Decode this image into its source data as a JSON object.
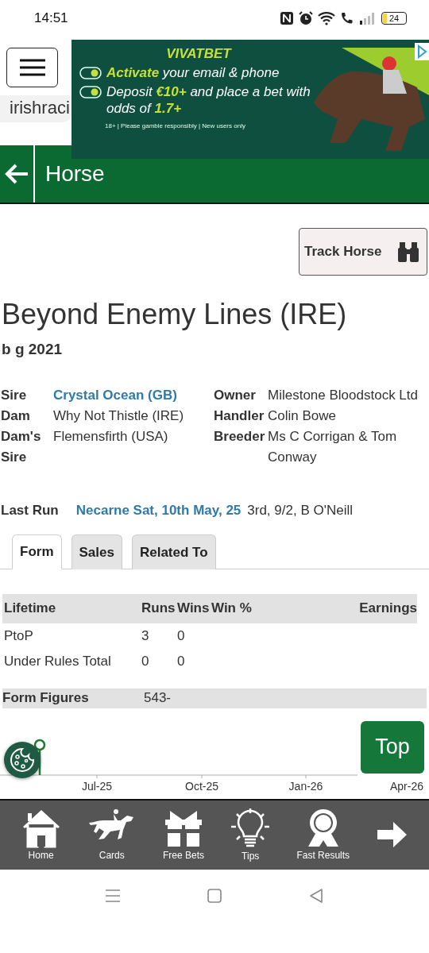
{
  "status_bar": {
    "time": "14:51",
    "battery": "24"
  },
  "site": {
    "logo_text": "irishraci"
  },
  "ad": {
    "brand": "VIVATBET",
    "lines": [
      "**Activate** your email & phone",
      "Deposit **€10+** and place a bet with odds of **1.7+**"
    ],
    "disclaimer": "18+ | Please gamble responsibly | New users only"
  },
  "header": {
    "title": "Horse"
  },
  "track_button": {
    "label": "Track Horse"
  },
  "horse": {
    "name": "Beyond Enemy Lines (IRE)",
    "details": "b g 2021"
  },
  "pedigree": [
    {
      "label": "Sire",
      "value": "Crystal Ocean (GB)",
      "link": true
    },
    {
      "label": "Dam",
      "value": "Why Not Thistle (IRE)",
      "link": false
    },
    {
      "label": "Dam's Sire",
      "value": "Flemensfirth (USA)",
      "link": false
    }
  ],
  "connections": [
    {
      "label": "Owner",
      "value": "Milestone Bloodstock Ltd"
    },
    {
      "label": "Handler",
      "value": "Colin Bowe"
    },
    {
      "label": "Breeder",
      "value": "Ms C Corrigan & Tom Conway"
    }
  ],
  "last_run": {
    "label": "Last Run",
    "race": "Necarne Sat, 10th May, 25",
    "result": "3rd, 9/2, B O'Neill"
  },
  "tabs": [
    {
      "label": "Form",
      "selected": true
    },
    {
      "label": "Sales",
      "selected": false
    },
    {
      "label": "Related To",
      "selected": false
    }
  ],
  "lifetime": {
    "columns": [
      "Lifetime",
      "Runs",
      "Wins",
      "Win %",
      "Earnings"
    ],
    "rows": [
      [
        "PtoP",
        "3",
        "0"
      ],
      [
        "Under Rules Total",
        "0",
        "0"
      ]
    ]
  },
  "form_figures": {
    "label": "Form Figures",
    "value": "543-"
  },
  "form_chart": {
    "axis_labels": [
      "Jul-25",
      "Oct-25",
      "Jan-26",
      "Apr-26"
    ]
  },
  "top_button": {
    "label": "Top"
  },
  "bottom_nav": [
    {
      "label": "Home",
      "kind": "home"
    },
    {
      "label": "Cards",
      "kind": "horse"
    },
    {
      "label": "Free Bets",
      "kind": "gift"
    },
    {
      "label": "Tips",
      "kind": "bulb"
    },
    {
      "label": "Fast Results",
      "kind": "rosette"
    },
    {
      "kind": "arrow"
    }
  ]
}
